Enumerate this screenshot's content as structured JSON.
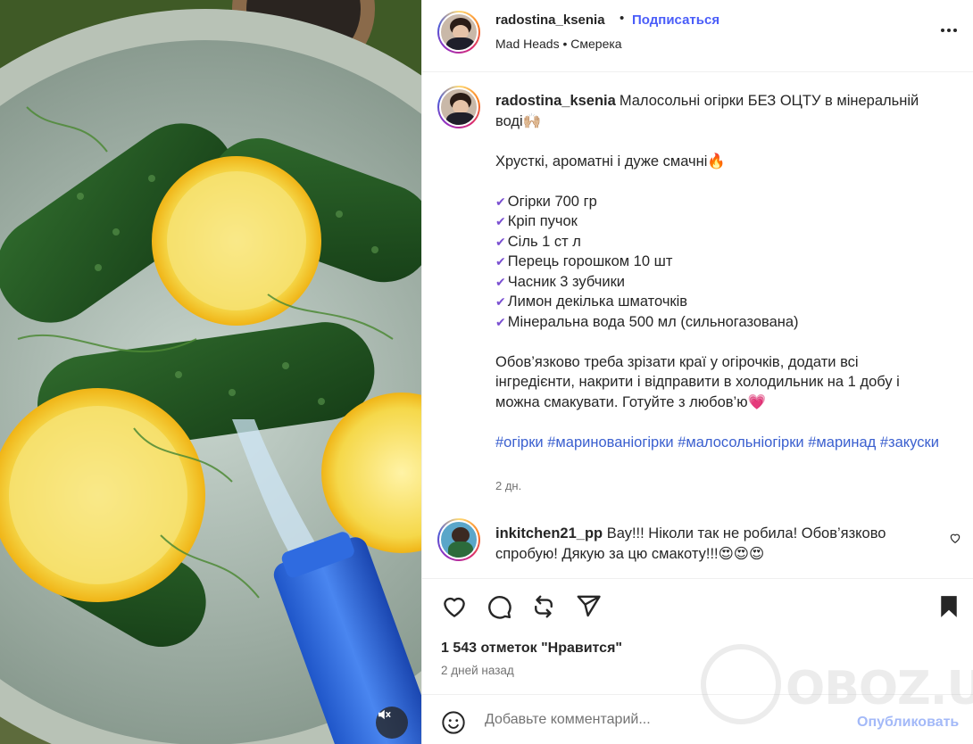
{
  "post": {
    "author": "radostina_ksenia",
    "follow_label": "Подписаться",
    "separator": "•",
    "subtitle": "Mad Heads • Смерека",
    "caption_title": "Малосольні огірки БЕЗ ОЦТУ в мінеральній воді🙌🏼",
    "caption_tagline": "Хрусткі, ароматні і дуже смачні🔥",
    "ingredients": [
      "Огірки 700 гр",
      "Кріп пучок",
      "Сіль 1 ст л",
      "Перець горошком 10 шт",
      "Часник 3 зубчики",
      "Лимон декілька шматочків",
      "Мінеральна вода 500 мл (сильногазована)"
    ],
    "instructions": "Обов’язково треба зрізати краї у огірочків, додати всі інгредієнти, накрити і відправити в холодильник на 1 добу і можна смакувати. Готуйте з любов’ю💗",
    "hashtags": [
      "#огірки",
      "#маринованіогірки",
      "#малосольніогірки",
      "#маринад",
      "#закуски"
    ],
    "caption_age": "2 дн."
  },
  "comments": [
    {
      "author": "inkitchen21_pp",
      "text": "Вау!!! Ніколи так не робила! Обов’язково спробую! Дякую за цю смакоту!!!😍😍😍"
    }
  ],
  "actions": {
    "likes_text": "1 543 отметок \"Нравится\"",
    "date_text": "2 дней назад"
  },
  "composer": {
    "placeholder": "Добавьте комментарий...",
    "publish_label": "Опубликовать"
  },
  "watermark": {
    "text": "OBOZ.UA"
  },
  "icons": {
    "more": "more-horizontal-icon",
    "like": "heart-icon",
    "comment": "comment-icon",
    "share": "repost-icon",
    "send": "send-icon",
    "save": "bookmark-icon",
    "emoji": "emoji-icon",
    "mute": "speaker-muted-icon"
  },
  "colors": {
    "accent": "#4a5df9",
    "hashtag": "#3a5fcf",
    "muted_text": "#737373",
    "publish_disabled": "#a3b9f8"
  }
}
